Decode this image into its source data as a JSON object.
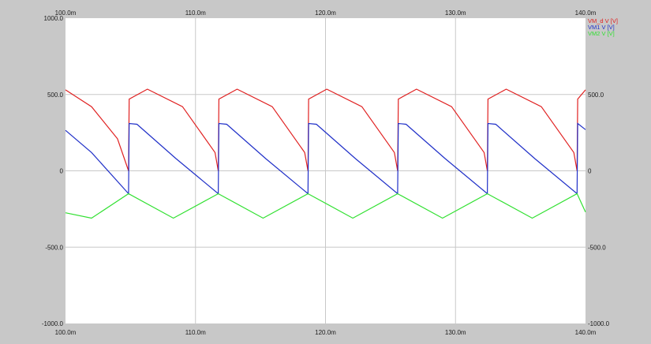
{
  "chart_data": {
    "type": "line",
    "title": "",
    "xlabel": "",
    "ylabel": "",
    "xlim": [
      100,
      140
    ],
    "ylim": [
      -1000,
      1000
    ],
    "x_ticks": [
      {
        "value": 100,
        "label": "100.0m"
      },
      {
        "value": 110,
        "label": "110.0m"
      },
      {
        "value": 120,
        "label": "120.0m"
      },
      {
        "value": 130,
        "label": "130.0m"
      },
      {
        "value": 140,
        "label": "140.0m"
      }
    ],
    "y_ticks_left": [
      {
        "value": 1000,
        "label": "1000.0"
      },
      {
        "value": 500,
        "label": "500.0"
      },
      {
        "value": 0,
        "label": "0"
      },
      {
        "value": -500,
        "label": "-500.0"
      },
      {
        "value": -1000,
        "label": "-1000.0"
      }
    ],
    "y_ticks_right": [
      {
        "value": 500,
        "label": "500.0"
      },
      {
        "value": 0,
        "label": "0"
      },
      {
        "value": -500,
        "label": "-500.0"
      },
      {
        "value": -1000,
        "label": "-1000.0"
      }
    ],
    "grid": true,
    "legend_position": "top-right",
    "series": [
      {
        "name": "VM_d V [V]",
        "color": "#e02020",
        "x": [
          100.0,
          102.0,
          104.0,
          104.85,
          104.9,
          106.3,
          109.0,
          111.5,
          111.75,
          111.8,
          113.2,
          115.9,
          118.4,
          118.65,
          118.7,
          120.1,
          122.8,
          125.3,
          125.55,
          125.6,
          127.0,
          129.7,
          132.2,
          132.45,
          132.5,
          133.9,
          136.6,
          139.1,
          139.35,
          139.4,
          140.0
        ],
        "values": [
          530,
          420,
          210,
          0,
          470,
          535,
          420,
          120,
          0,
          470,
          535,
          420,
          120,
          0,
          470,
          535,
          420,
          120,
          0,
          470,
          535,
          420,
          120,
          0,
          470,
          535,
          420,
          120,
          0,
          470,
          530
        ]
      },
      {
        "name": "VM1 V [V]",
        "color": "#2030c8",
        "x": [
          100.0,
          102.0,
          104.85,
          104.9,
          105.5,
          108.5,
          111.75,
          111.8,
          112.4,
          115.4,
          118.65,
          118.7,
          119.3,
          122.3,
          125.55,
          125.6,
          126.2,
          129.2,
          132.45,
          132.5,
          133.1,
          136.1,
          139.35,
          139.4,
          140.0
        ],
        "values": [
          265,
          120,
          -150,
          310,
          305,
          80,
          -150,
          310,
          305,
          80,
          -150,
          310,
          305,
          80,
          -150,
          310,
          305,
          80,
          -150,
          310,
          305,
          80,
          -150,
          310,
          270
        ]
      },
      {
        "name": "VM2 V [V]",
        "color": "#30e030",
        "x": [
          100.0,
          102.0,
          104.85,
          108.3,
          111.75,
          115.2,
          118.65,
          122.1,
          125.55,
          129.0,
          132.45,
          135.9,
          139.35,
          140.0
        ],
        "values": [
          -275,
          -310,
          -150,
          -310,
          -150,
          -310,
          -150,
          -310,
          -150,
          -310,
          -150,
          -310,
          -150,
          -270
        ]
      }
    ]
  }
}
